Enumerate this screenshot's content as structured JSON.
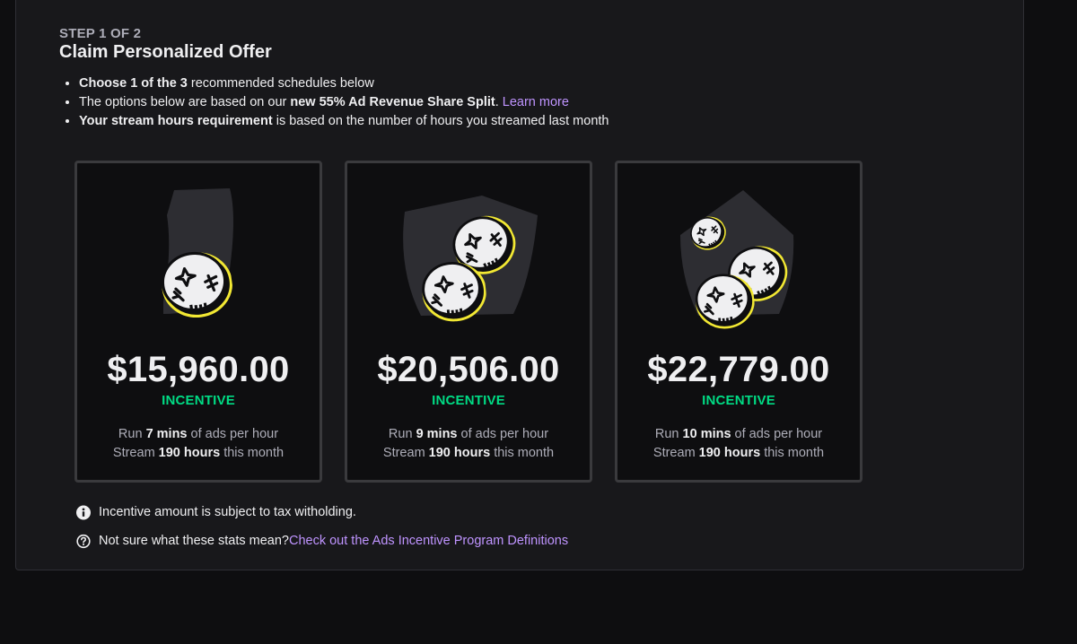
{
  "header": {
    "step": "STEP 1 OF 2",
    "title": "Claim Personalized Offer"
  },
  "bullets": {
    "b1": {
      "bold1": "Choose 1 of the 3",
      "rest": " recommended schedules below"
    },
    "b2": {
      "pre": "The options below are based on our ",
      "bold": "new 55% Ad Revenue Share Split",
      "post": ". ",
      "link": "Learn more"
    },
    "b3": {
      "bold": "Your stream hours requirement",
      "rest": " is based on the number of hours you streamed last month"
    }
  },
  "offers": [
    {
      "amount": "$15,960.00",
      "label": "INCENTIVE",
      "run_pre": "Run ",
      "run_bold": "7 mins",
      "run_post": " of ads per hour",
      "stream_pre": "Stream ",
      "stream_bold": "190 hours",
      "stream_post": " this month"
    },
    {
      "amount": "$20,506.00",
      "label": "INCENTIVE",
      "run_pre": "Run ",
      "run_bold": "9 mins",
      "run_post": " of ads per hour",
      "stream_pre": "Stream ",
      "stream_bold": "190 hours",
      "stream_post": " this month"
    },
    {
      "amount": "$22,779.00",
      "label": "INCENTIVE",
      "run_pre": "Run ",
      "run_bold": "10 mins",
      "run_post": " of ads per hour",
      "stream_pre": "Stream ",
      "stream_bold": "190 hours",
      "stream_post": " this month"
    }
  ],
  "notes": {
    "tax": "Incentive amount is subject to tax witholding.",
    "help_pre": "Not sure what these stats mean? ",
    "help_link": "Check out the Ads Incentive Program Definitions"
  },
  "colors": {
    "accent_link": "#bf94ff",
    "incentive_green": "#00db84",
    "coin_rim": "#f2e833",
    "panel_bg": "#18181b",
    "page_bg": "#0e0e10"
  },
  "icons": {
    "card_1": "single-coin-icon",
    "card_2": "two-coins-icon",
    "card_3": "three-coins-icon",
    "note_1": "info-icon",
    "note_2": "question-icon"
  }
}
